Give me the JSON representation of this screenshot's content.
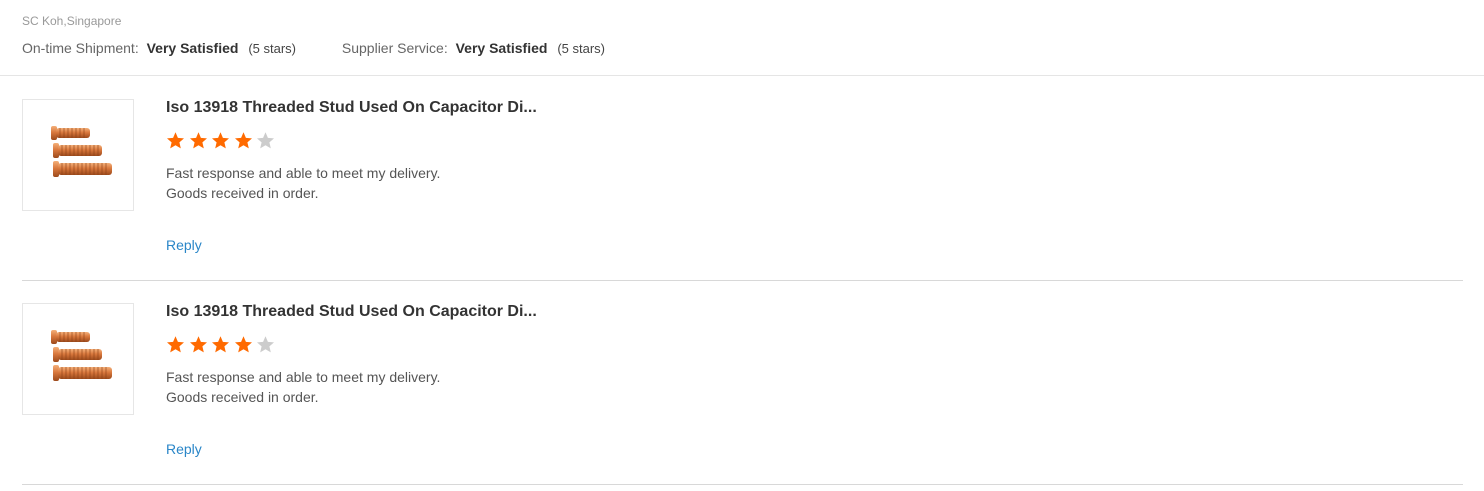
{
  "header": {
    "reviewer": "SC Koh,Singapore",
    "ratings": [
      {
        "label": "On-time Shipment:",
        "value": "Very Satisfied",
        "stars_text": "(5 stars)"
      },
      {
        "label": "Supplier Service:",
        "value": "Very Satisfied",
        "stars_text": "(5 stars)"
      }
    ]
  },
  "reviews": [
    {
      "product_title": "Iso 13918 Threaded Stud Used On Capacitor Di...",
      "rating": 4,
      "max_rating": 5,
      "comment_lines": [
        "Fast response and able to meet my delivery.",
        "Goods received in order."
      ],
      "reply_label": "Reply",
      "thumbnail_icon": "copper-threaded-stud-image"
    },
    {
      "product_title": "Iso 13918 Threaded Stud Used On Capacitor Di...",
      "rating": 4,
      "max_rating": 5,
      "comment_lines": [
        "Fast response and able to meet my delivery.",
        "Goods received in order."
      ],
      "reply_label": "Reply",
      "thumbnail_icon": "copper-threaded-stud-image"
    }
  ],
  "colors": {
    "star_filled": "#ff6a00",
    "star_empty": "#cccccc",
    "link": "#2a86c8",
    "divider": "#d8d8d8"
  }
}
